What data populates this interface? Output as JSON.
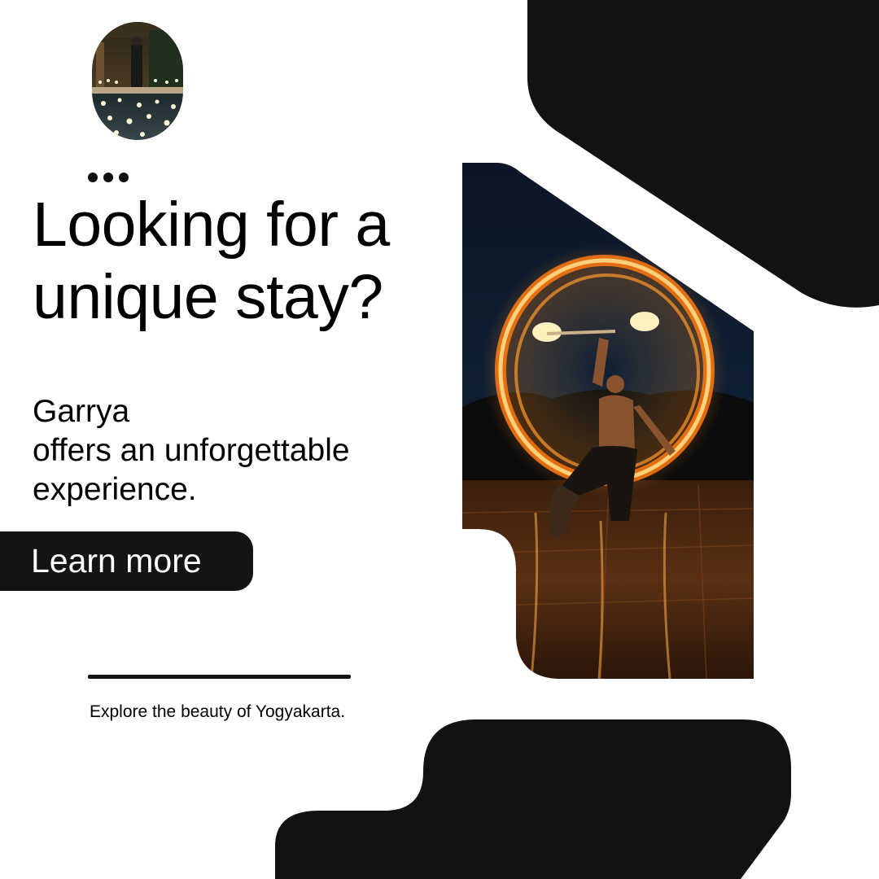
{
  "headline": {
    "line1": "Looking for a",
    "line2": "unique stay?"
  },
  "body": {
    "line1": "Garrya",
    "line2": "offers an unforgettable",
    "line3": "experience."
  },
  "cta": {
    "label": "Learn more"
  },
  "footer": {
    "tagline": "Explore the beauty of Yogyakarta."
  },
  "colors": {
    "dark": "#121212",
    "background": "#ffffff",
    "fire": "#ff9a2e"
  }
}
